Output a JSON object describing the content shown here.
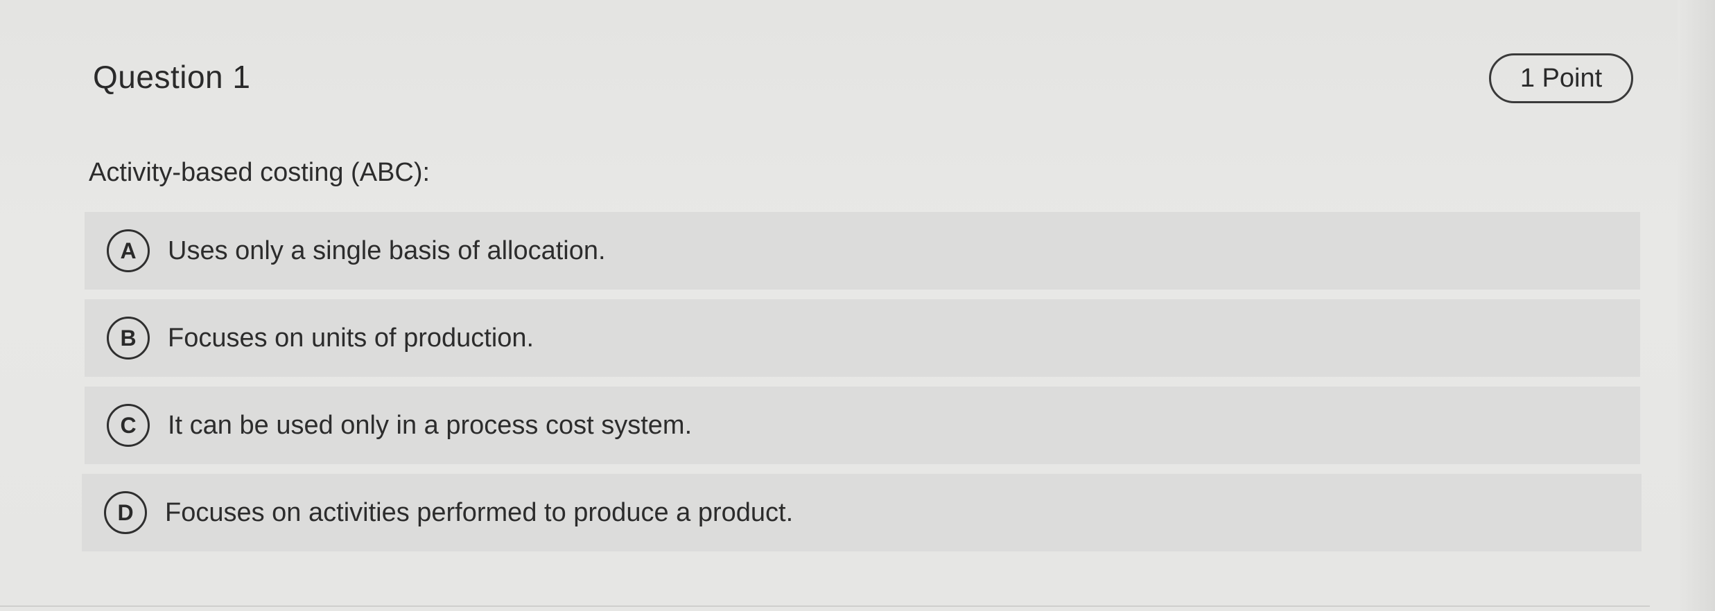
{
  "question": {
    "title": "Question 1",
    "points": "1 Point",
    "prompt": "Activity-based costing (ABC):"
  },
  "options": [
    {
      "letter": "A",
      "text": "Uses only a single basis of allocation."
    },
    {
      "letter": "B",
      "text": "Focuses on units of production."
    },
    {
      "letter": "C",
      "text": "It can be used only in a process cost system."
    },
    {
      "letter": "D",
      "text": "Focuses on activities performed to produce a product."
    }
  ]
}
